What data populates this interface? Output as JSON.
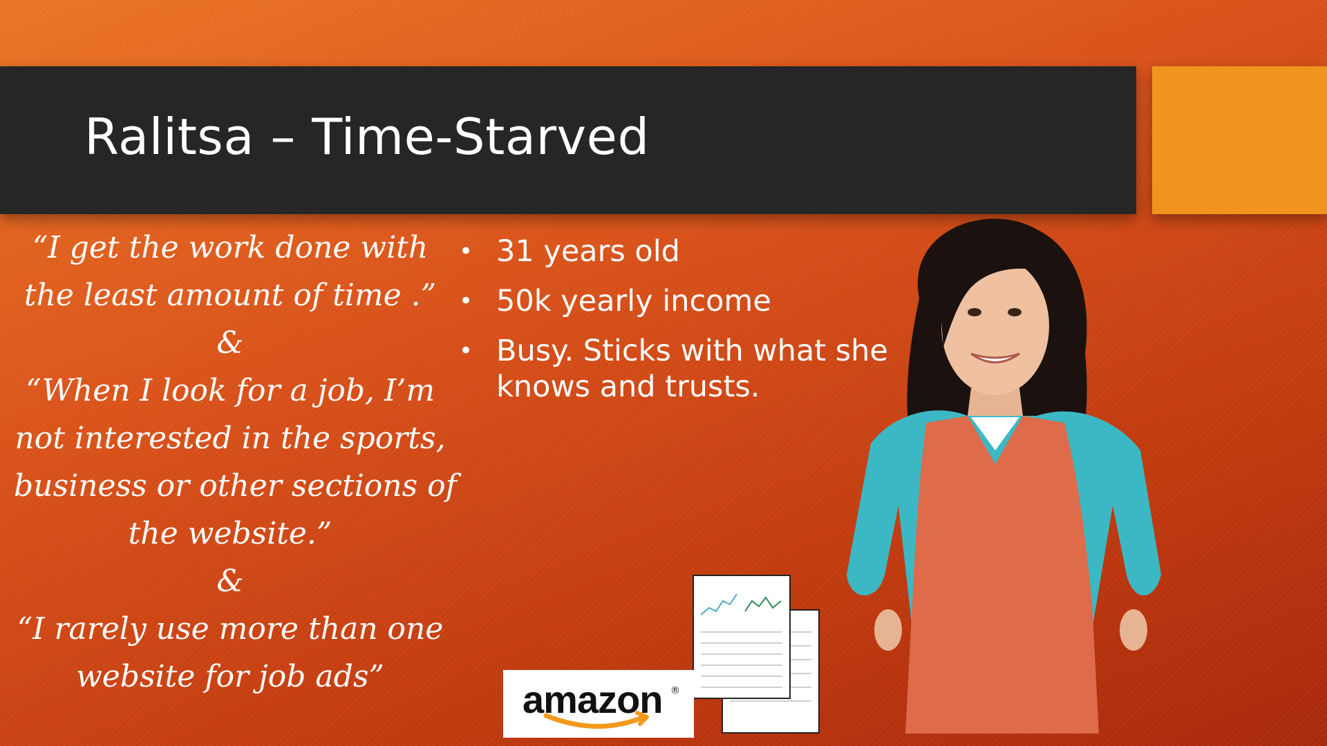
{
  "slide": {
    "title": "Ralitsa – Time-Starved",
    "accent_color": "#f0941d",
    "title_bar_color": "#262626"
  },
  "quote": {
    "lines": [
      "“I  get the work done with",
      "the least amount of time .”",
      "&",
      "“When I look for a job, I’m",
      "not interested in the sports,",
      "business or other sections of",
      "the website.”",
      "&",
      "“I rarely use more than one",
      "website for job ads”"
    ]
  },
  "bullets": [
    {
      "marker": "•",
      "text": "31 years old"
    },
    {
      "marker": "•",
      "text": "50k yearly income"
    },
    {
      "marker": "•",
      "text": "Busy. Sticks with what she knows and trusts."
    }
  ],
  "logo": {
    "text": "amazon",
    "registered": "®"
  },
  "images": {
    "portrait": "woman-portrait",
    "document": "newspaper-pages-icon"
  }
}
